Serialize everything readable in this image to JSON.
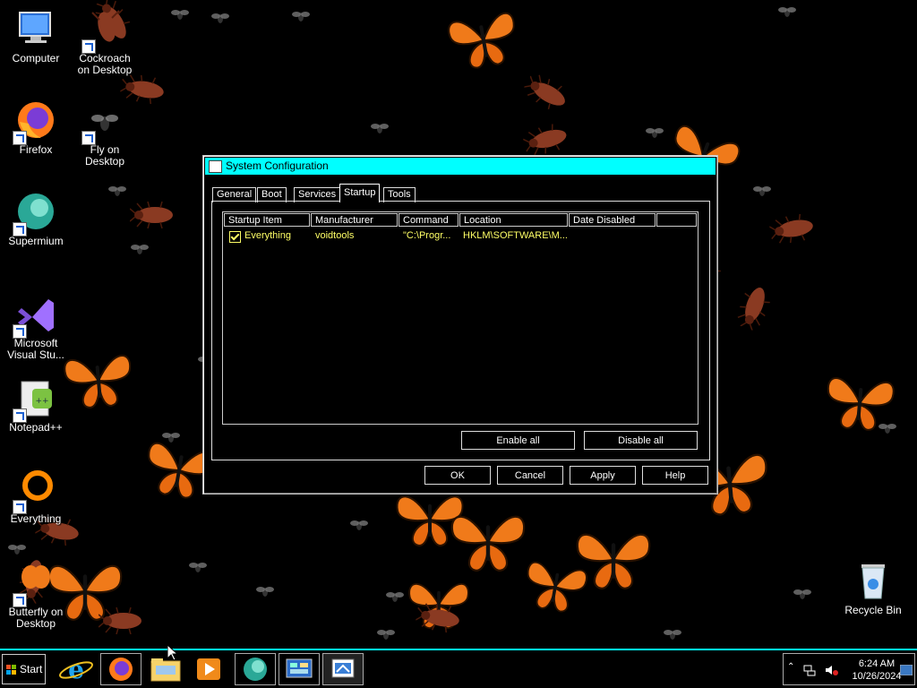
{
  "desktop": {
    "icons": [
      {
        "label": "Computer"
      },
      {
        "label": "Cockroach\non Desktop"
      },
      {
        "label": "Firefox"
      },
      {
        "label": "Fly on\nDesktop"
      },
      {
        "label": "Supermium"
      },
      {
        "label": "Microsoft\nVisual Stu..."
      },
      {
        "label": "Notepad++"
      },
      {
        "label": "Everything"
      },
      {
        "label": "Butterfly on\nDesktop"
      },
      {
        "label": "Recycle Bin"
      }
    ]
  },
  "dialog": {
    "title": "System Configuration",
    "tabs": [
      "General",
      "Boot",
      "Services",
      "Startup",
      "Tools"
    ],
    "active_tab": "Startup",
    "columns": [
      "Startup Item",
      "Manufacturer",
      "Command",
      "Location",
      "Date Disabled"
    ],
    "rows": [
      {
        "checked": true,
        "item": "Everything",
        "manufacturer": "voidtools",
        "command": "\"C:\\Progr...",
        "location": "HKLM\\SOFTWARE\\M...",
        "date_disabled": ""
      }
    ],
    "enable_all": "Enable all",
    "disable_all": "Disable all",
    "ok": "OK",
    "cancel": "Cancel",
    "apply": "Apply",
    "help": "Help",
    "text_color": "#ffff66",
    "title_color": "#00ffff"
  },
  "taskbar": {
    "start": "Start",
    "items": [
      "internet-explorer",
      "firefox",
      "file-explorer",
      "media-player",
      "supermium",
      "control-panel",
      "system-configuration"
    ],
    "clock_time": "6:24 AM",
    "clock_date": "10/26/2024"
  }
}
